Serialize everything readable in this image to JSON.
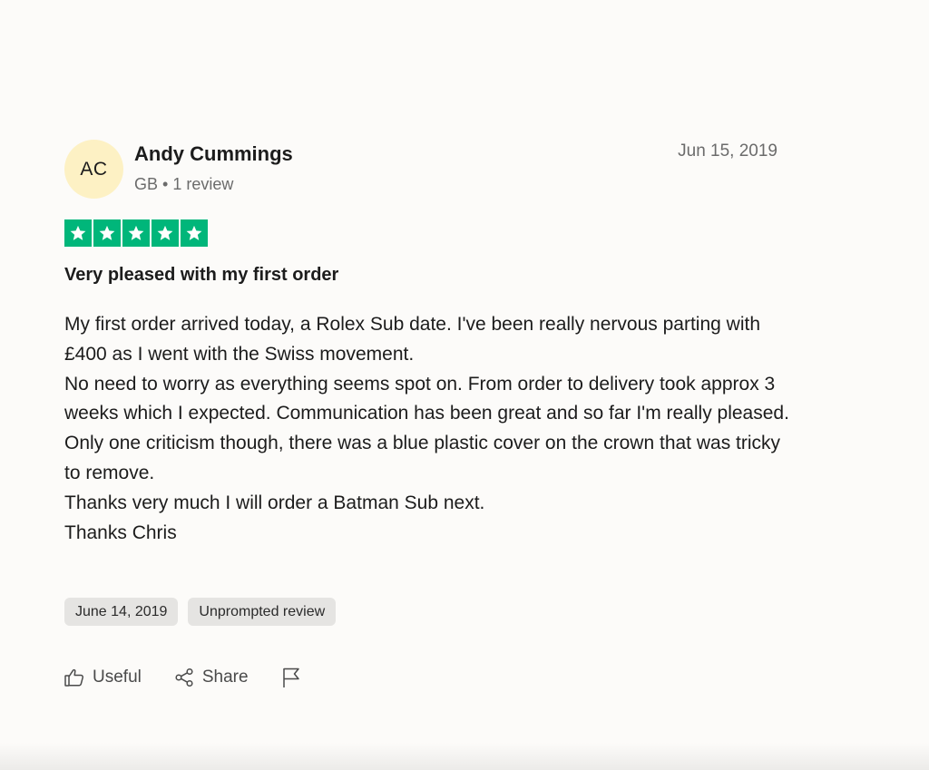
{
  "review": {
    "reviewer": {
      "initials": "AC",
      "name": "Andy Cummings",
      "country": "GB",
      "review_count": "1 review"
    },
    "date": "Jun 15, 2019",
    "rating": 5,
    "rating_max": 5,
    "star_color": "#00b67a",
    "title": "Very pleased with my first order",
    "body": [
      "My first order arrived today, a Rolex Sub date. I've been really nervous parting with £400 as I went with the Swiss movement.",
      "No need to worry as everything seems spot on. From order to delivery took approx 3 weeks which I expected. Communication has been great and so far I'm really pleased.",
      "Only one criticism though, there was a blue plastic cover on the crown that was tricky to remove.",
      "Thanks very much I will order a Batman Sub next.",
      "Thanks Chris"
    ],
    "tags": [
      "June 14, 2019",
      "Unprompted review"
    ],
    "actions": {
      "useful_label": "Useful",
      "share_label": "Share",
      "useful_icon": "thumbs-up-icon",
      "share_icon": "share-icon",
      "report_icon": "flag-icon"
    }
  }
}
